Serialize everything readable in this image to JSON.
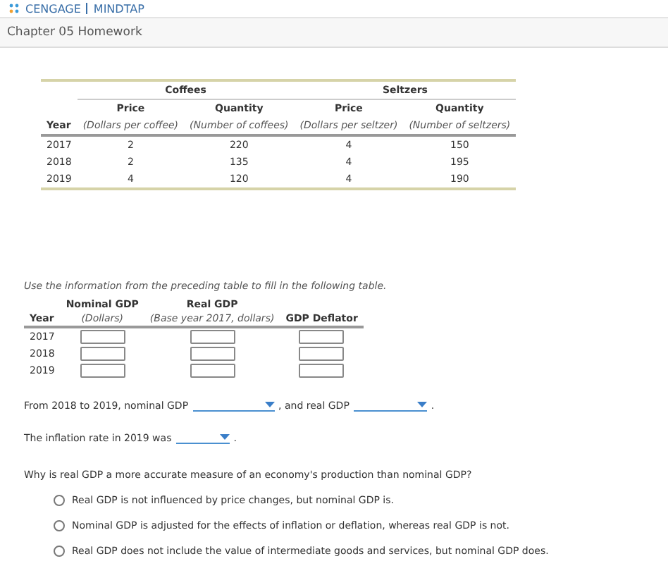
{
  "brand": {
    "name": "CENGAGE",
    "product": "MINDTAP"
  },
  "chapter_title": "Chapter 05 Homework",
  "data_table": {
    "groups": [
      "Coffees",
      "Seltzers"
    ],
    "columns": [
      {
        "label": "Year"
      },
      {
        "label": "Price",
        "unit": "(Dollars per coffee)"
      },
      {
        "label": "Quantity",
        "unit": "(Number of coffees)"
      },
      {
        "label": "Price",
        "unit": "(Dollars per seltzer)"
      },
      {
        "label": "Quantity",
        "unit": "(Number of seltzers)"
      }
    ],
    "rows": [
      [
        "2017",
        "2",
        "220",
        "4",
        "150"
      ],
      [
        "2018",
        "2",
        "135",
        "4",
        "195"
      ],
      [
        "2019",
        "4",
        "120",
        "4",
        "190"
      ]
    ]
  },
  "instruction": "Use the information from the preceding table to fill in the following table.",
  "answer_table": {
    "columns": [
      {
        "label": "Year"
      },
      {
        "label": "Nominal GDP",
        "unit": "(Dollars)"
      },
      {
        "label": "Real GDP",
        "unit": "(Base year 2017, dollars)"
      },
      {
        "label": "GDP Deflator"
      }
    ],
    "rows": [
      "2017",
      "2018",
      "2019"
    ]
  },
  "sentence_1": {
    "part_1": "From 2018 to 2019, nominal GDP",
    "part_2": ", and real GDP",
    "part_3": "."
  },
  "sentence_2": {
    "part_1": "The inflation rate in 2019 was",
    "part_2": "."
  },
  "question": "Why is real GDP a more accurate measure of an economy's production than nominal GDP?",
  "options": [
    {
      "label": "Real GDP is not influenced by price changes, but nominal GDP is.",
      "selected": false
    },
    {
      "label": "Nominal GDP is adjusted for the effects of inflation or deflation, whereas real GDP is not.",
      "selected": false
    },
    {
      "label": "Real GDP does not include the value of intermediate goods and services, but nominal GDP does.",
      "selected": false
    }
  ]
}
